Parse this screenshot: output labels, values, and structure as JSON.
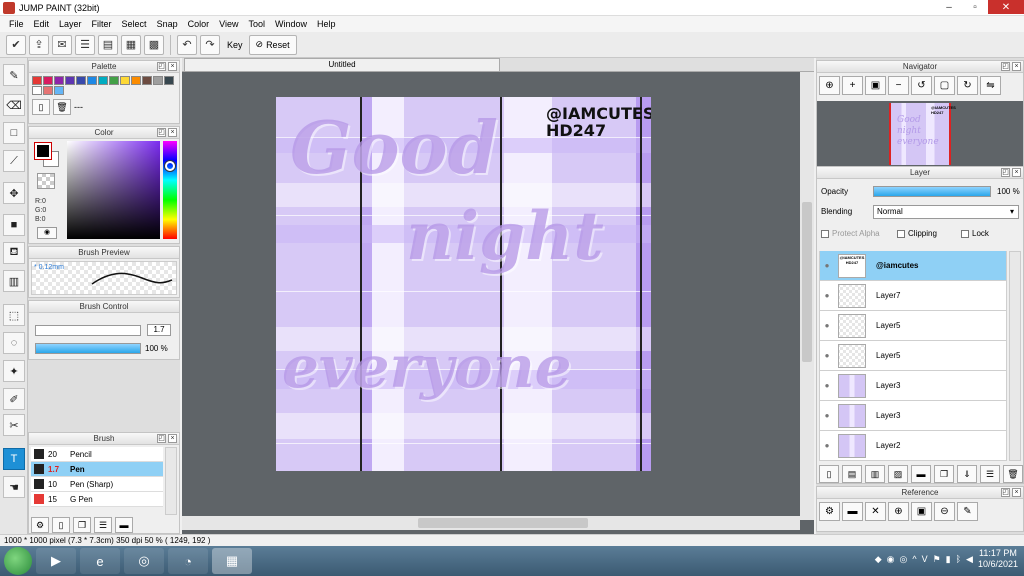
{
  "window": {
    "title": "JUMP PAINT (32bit)",
    "controls": [
      "–",
      "▫",
      "✕"
    ]
  },
  "menu": [
    "File",
    "Edit",
    "Layer",
    "Filter",
    "Select",
    "Snap",
    "Color",
    "View",
    "Tool",
    "Window",
    "Help"
  ],
  "toolbar": {
    "key_label": "Key",
    "reset_label": "Reset"
  },
  "panels": {
    "palette": "Palette",
    "palette_text": "---",
    "color": "Color",
    "brush_preview": "Brush Preview",
    "brush_control": "Brush Control",
    "brush": "Brush",
    "navigator": "Navigator",
    "layer": "Layer",
    "reference": "Reference"
  },
  "palette_colors": [
    "#e53935",
    "#d81b60",
    "#8e24aa",
    "#5e35b1",
    "#3949ab",
    "#1e88e5",
    "#00acc1",
    "#43a047",
    "#fdd835",
    "#fb8c00",
    "#6d4c41",
    "#9e9e9e",
    "#37474f",
    "#ffffff",
    "#e57373",
    "#64b5f6"
  ],
  "color": {
    "r": "R:0",
    "g": "G:0",
    "b": "B:0"
  },
  "brush_preview": {
    "size": "* 0.12mm"
  },
  "brush_control": {
    "size_value": "1.7",
    "opacity_label": "100 %",
    "opacity": 1.0
  },
  "brushes": [
    {
      "size": "20",
      "name": "Pencil",
      "color": "#222222",
      "selected": false
    },
    {
      "size": "1.7",
      "name": "Pen",
      "color": "#222222",
      "selected": true
    },
    {
      "size": "10",
      "name": "Pen (Sharp)",
      "color": "#222222",
      "selected": false
    },
    {
      "size": "15",
      "name": "G Pen",
      "color": "#e53935",
      "selected": false
    }
  ],
  "document": {
    "tab": "Untitled"
  },
  "artwork": {
    "line1": "Good",
    "line2": "night",
    "line3": "everyone",
    "signature1": "@IAMCUTES",
    "signature2": "HD247"
  },
  "layer_panel": {
    "opacity_label": "Opacity",
    "opacity_value": "100 %",
    "opacity": 1.0,
    "blending_label": "Blending",
    "blending_value": "Normal",
    "protect_alpha": "Protect Alpha",
    "clipping": "Clipping",
    "lock": "Lock",
    "layers": [
      {
        "name": "@iamcutes",
        "thumb": "txt",
        "selected": true
      },
      {
        "name": "Layer7",
        "thumb": "blank",
        "selected": false
      },
      {
        "name": "Layer5",
        "thumb": "blank",
        "selected": false
      },
      {
        "name": "Layer5",
        "thumb": "blank",
        "selected": false
      },
      {
        "name": "Layer3",
        "thumb": "art",
        "selected": false
      },
      {
        "name": "Layer3",
        "thumb": "art",
        "selected": false
      },
      {
        "name": "Layer2",
        "thumb": "art",
        "selected": false
      }
    ]
  },
  "status": "1000 * 1000 pixel   (7.3 * 7.3cm)   350 dpi   50 %   ( 1249, 192 )",
  "taskbar": {
    "time": "11:17 PM",
    "date": "10/6/2021"
  }
}
